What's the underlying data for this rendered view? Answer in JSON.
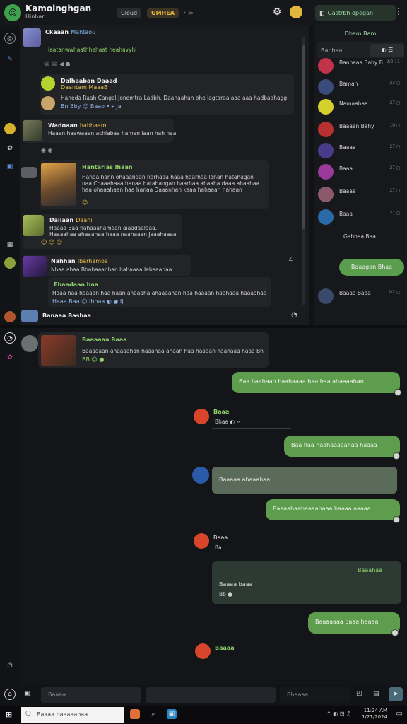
{
  "header": {
    "app_title": "Kamolnghgan",
    "app_subtitle": "Hinhar",
    "chip1": "Cloud",
    "chip2": "GMHEA",
    "dots": "• ≫",
    "right_tab": "Gastrbh dpegan",
    "kebab": "⋮"
  },
  "upper_feed": {
    "messages": [
      {
        "name": "Ckaaan",
        "tag": "Mahtaou",
        "text": "Iaatanwwhaathhehaat heahavyhi",
        "reacts": "☺ ☺ ◀ ●"
      },
      {
        "name": "Dalhaaban Daaad",
        "sub": "Daantam MaaaB",
        "text": "Haneda Raah Cangal Jonemtra Ladbh. Daanaahan ohe lagtaraa aaa aaa hadbaahaggrtanlaa",
        "reacts": "Bn  Bby  ☺  Baao  •  ▸  Ja"
      },
      {
        "name": "Wadoaan",
        "tag": "hahhaam",
        "text": "Haaan haawaaan achlabaa haman laan hah haa",
        "reacts": "◉ ◉"
      },
      {
        "name": "Hantarias lhaan",
        "text": "Hanaa hann ohaaahaan narhaaa haaa haarhaa lanan hatahagan naa Chaaahaaa hanaa hatahangan haarhaa ahaaha daaa ahaahaa haa ohaaahaan haa hanaa Daaanhan kaaa hahaaan hahaan",
        "reacts": "☺"
      },
      {
        "name": "Daliaan",
        "tag": "Daani",
        "text": "Haaaa Baa hahaaahamaan aiaadaalaaa. Haaaahaa ahaaahaa haaa naahaaan Jaaahaaaa",
        "reacts": "☺ ☺ ☺"
      },
      {
        "name": "Nahhan",
        "tag": "Ibarhamoa",
        "text": "Nhaa ahaa Bbahaaanhan hahaaaa Iabaaahaa",
        "reacts": "∠"
      },
      {
        "name": "Ehaadaaa haa",
        "text": "Haaa haa haaaan haa haan ahaaaha ahaaaahan haa haaaan haahaaa haaaahaaa haaahaan Haaaahaa Haaa",
        "reacts": "Haaa  Baa  ☺  Ibhaa  ◐  ◉  IJ"
      }
    ],
    "footer_name": "Banaaa Bashaa"
  },
  "side_panel": {
    "title": "Dbam Bam",
    "filter": "Banhaa",
    "filter_btn": "◐ ☰",
    "members": [
      {
        "name": "Banhaaa Bahy B",
        "num": "2/2 11"
      },
      {
        "name": "Baman",
        "num": "23 ◻"
      },
      {
        "name": "Namaahaa",
        "num": "27 ◻"
      },
      {
        "name": "Baaaan Bahy",
        "num": "10 ◻"
      },
      {
        "name": "Baaaa",
        "num": "27 ◻"
      },
      {
        "name": "Baaa",
        "num": "27 ◻"
      },
      {
        "name": "Baaaa",
        "num": "27 ◻"
      },
      {
        "name": "Baaa",
        "num": "27 ◻"
      },
      {
        "name": "Gahhaa Baa",
        "num": ""
      }
    ],
    "button": "Baaagan Bhaa",
    "bottom_member": {
      "name": "Baaaa Baaa",
      "num": "2/2 ◻"
    }
  },
  "lower_chat": {
    "first_msg": {
      "name": "Baaaaaa Baaa",
      "text": "Baaaaaan ahaaaahan haaahaa ahaan haa haaaan haahaaa haaa Bhaa",
      "reacts": "BB ☺ ●"
    },
    "out1": "Baa baahaan haahaaaa haa haa ahaaaahan",
    "in1": {
      "name": "Baaa",
      "meta": "Bhaa ◐  ⚬"
    },
    "out2": "Baa haa haahaaaaahaa haaaa",
    "in2_text": "Baaaaa ahaaahaa",
    "out3": "Baaaahaahaaaahaaa haaaa aaaaa",
    "in3": {
      "name": "Baaa",
      "meta": "Ba"
    },
    "dark_card": {
      "tag": "Baaahaa",
      "text": "Baaaa baaa",
      "meta": "Bb ●"
    },
    "out4": "Baaaaaaa baaa haaaa",
    "in4": {
      "name": "Baaaa"
    }
  },
  "composer": {
    "placeholder1": "Baaaa",
    "placeholder2": "",
    "placeholder3": "Bhaaaa"
  },
  "taskbar": {
    "search": "Baaaa baaaaahaa",
    "time": "11:24 AM",
    "date": "1/21/2024"
  }
}
